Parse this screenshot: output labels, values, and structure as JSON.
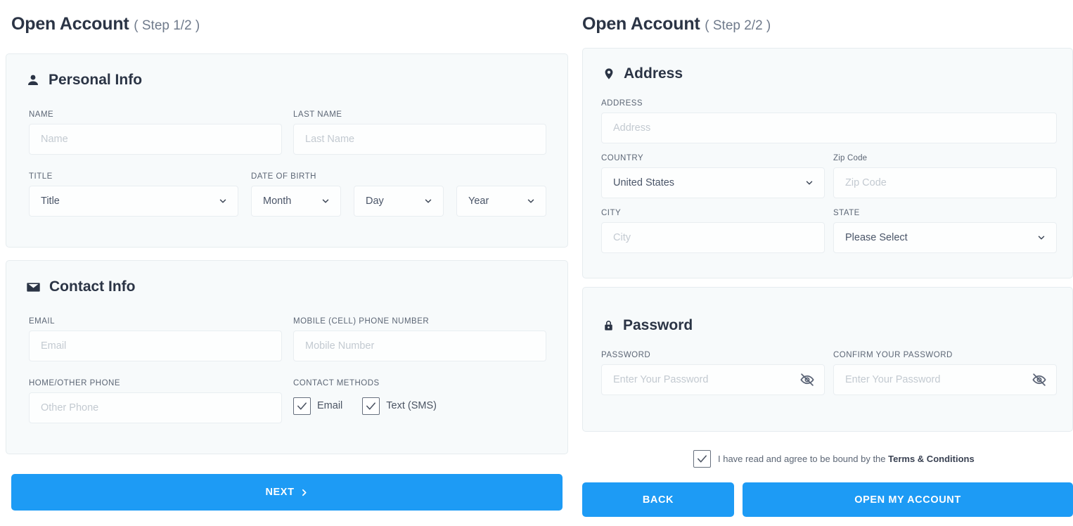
{
  "steps": {
    "left": {
      "title": "Open Account",
      "sub": "( Step 1/2 )"
    },
    "right": {
      "title": "Open Account",
      "sub": "( Step 2/2 )"
    }
  },
  "personal_info": {
    "section_title": "Personal Info",
    "icon": "person-icon",
    "fields": {
      "name": {
        "label": "NAME",
        "placeholder": "Name",
        "value": ""
      },
      "last_name": {
        "label": "LAST NAME",
        "placeholder": "Last Name",
        "value": ""
      },
      "title": {
        "label": "TITLE",
        "selected": "Title"
      },
      "dob": {
        "label": "DATE OF BIRTH"
      },
      "month": {
        "selected": "Month"
      },
      "day": {
        "selected": "Day"
      },
      "year": {
        "selected": "Year"
      }
    }
  },
  "contact_info": {
    "section_title": "Contact Info",
    "icon": "envelope-icon",
    "fields": {
      "email": {
        "label": "EMAIL",
        "placeholder": "Email",
        "value": ""
      },
      "mobile": {
        "label": "MOBILE (CELL) PHONE NUMBER",
        "placeholder": "Mobile Number",
        "value": ""
      },
      "other_phone": {
        "label": "HOME/OTHER PHONE",
        "placeholder": "Other Phone",
        "value": ""
      },
      "methods": {
        "label": "CONTACT METHODS"
      }
    },
    "contact_methods": [
      {
        "label": "Email",
        "checked": true
      },
      {
        "label": "Text (SMS)",
        "checked": true
      }
    ]
  },
  "address": {
    "section_title": "Address",
    "icon": "location-pin-icon",
    "fields": {
      "address": {
        "label": "ADDRESS",
        "placeholder": "Address",
        "value": ""
      },
      "country": {
        "label": "COUNTRY",
        "selected": "United States"
      },
      "zip": {
        "label": "Zip Code",
        "placeholder": "Zip Code",
        "value": ""
      },
      "city": {
        "label": "CITY",
        "placeholder": "City",
        "value": ""
      },
      "state": {
        "label": "STATE",
        "selected": "Please Select"
      }
    }
  },
  "password": {
    "section_title": "Password",
    "icon": "lock-icon",
    "fields": {
      "password": {
        "label": "PASSWORD",
        "placeholder": "Enter Your Password",
        "value": ""
      },
      "confirm": {
        "label": "CONFIRM YOUR PASSWORD",
        "placeholder": "Enter Your Password",
        "value": ""
      }
    },
    "toggle_icon": "eye-off-icon"
  },
  "terms": {
    "checked": true,
    "text": "I have read and agree to be bound by the ",
    "link": "Terms & Conditions"
  },
  "buttons": {
    "next": "NEXT",
    "back": "BACK",
    "open": "OPEN MY ACCOUNT"
  },
  "colors": {
    "accent": "#1d9bf5",
    "heading": "#2b3445",
    "card_bg": "#f7fafb",
    "card_border": "#e6ecef",
    "label": "#5c6675",
    "placeholder": "#c3cad1"
  }
}
